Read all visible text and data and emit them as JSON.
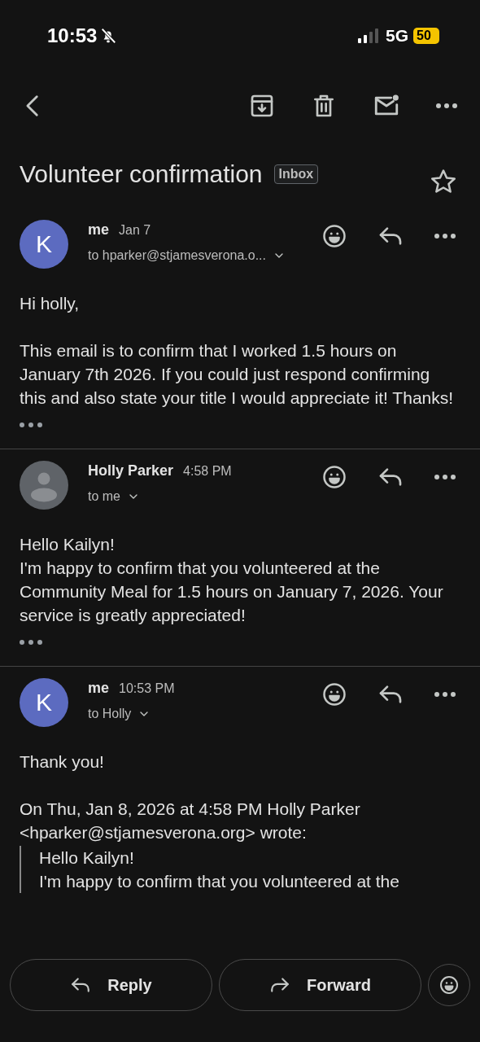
{
  "status_bar": {
    "time": "10:53",
    "silent": true,
    "network": "5G",
    "battery": "50"
  },
  "subject": {
    "title": "Volunteer confirmation",
    "label": "Inbox",
    "starred": false
  },
  "messages": [
    {
      "sender": "me",
      "date": "Jan 7",
      "recipient": "to hparker@stjamesverona.o...",
      "avatar": {
        "kind": "letter",
        "letter": "K",
        "color": "#5c6bc0"
      },
      "body": "Hi holly,\n\nThis email is to confirm that I worked 1.5 hours on January 7th 2026. If you could just respond confirming this and also state your title I would appreciate it! Thanks!",
      "trimmed": true
    },
    {
      "sender": "Holly Parker",
      "date": "4:58 PM",
      "recipient": "to me",
      "avatar": {
        "kind": "person"
      },
      "body": "Hello Kailyn!\nI'm happy to confirm that you volunteered at the Community Meal for 1.5 hours on January 7, 2026. Your service is greatly appreciated!",
      "trimmed": true
    },
    {
      "sender": "me",
      "date": "10:53 PM",
      "recipient": "to Holly",
      "avatar": {
        "kind": "letter",
        "letter": "K",
        "color": "#5c6bc0"
      },
      "body": "Thank you!\n\nOn Thu, Jan 8, 2026 at 4:58 PM Holly Parker <hparker@stjamesverona.org> wrote:",
      "quote": "Hello Kailyn!\nI'm happy to confirm that you volunteered at the"
    }
  ],
  "actions": {
    "reply": "Reply",
    "forward": "Forward"
  }
}
